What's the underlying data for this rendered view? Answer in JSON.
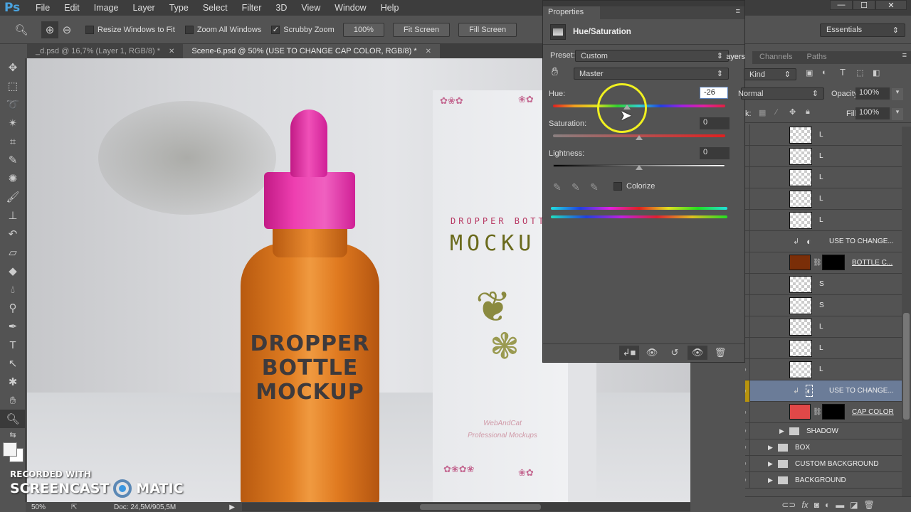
{
  "app": {
    "logo": "Ps"
  },
  "menu": [
    "File",
    "Edit",
    "Image",
    "Layer",
    "Type",
    "Select",
    "Filter",
    "3D",
    "View",
    "Window",
    "Help"
  ],
  "window_controls": {
    "minimize": "—",
    "maximize": "☐",
    "close": "✕"
  },
  "options_bar": {
    "resize_windows": {
      "label": "Resize Windows to Fit",
      "checked": false
    },
    "zoom_all": {
      "label": "Zoom All Windows",
      "checked": false
    },
    "scrubby_zoom": {
      "label": "Scrubby Zoom",
      "checked": true
    },
    "zoom_100": "100%",
    "fit_screen": "Fit Screen",
    "fill_screen": "Fill Screen",
    "workspace": "Essentials"
  },
  "doc_tabs": [
    {
      "label": "_d.psd @ 16,7% (Layer 1, RGB/8) *",
      "active": false
    },
    {
      "label": "Scene-6.psd @ 50% (USE TO CHANGE CAP COLOR, RGB/8) *",
      "active": true
    }
  ],
  "canvas": {
    "bottle_label": [
      "DROPPER",
      "BOTTLE",
      "MOCKUP"
    ],
    "box_subtitle": "DROPPER BOTT",
    "box_title": "MOCKU",
    "box_brand": "WebAndCat",
    "box_tagline": "Professional Mockups",
    "colors": {
      "cap": "#e83eaa",
      "bottle": "#e07a20"
    }
  },
  "properties": {
    "tab": "Properties",
    "adjustment": "Hue/Saturation",
    "preset_label": "Preset:",
    "preset_value": "Custom",
    "channel": "Master",
    "hue": {
      "label": "Hue:",
      "value": "-26",
      "min": -180,
      "max": 180
    },
    "saturation": {
      "label": "Saturation:",
      "value": "0",
      "min": -100,
      "max": 100
    },
    "lightness": {
      "label": "Lightness:",
      "value": "0",
      "min": -100,
      "max": 100
    },
    "colorize": {
      "label": "Colorize",
      "checked": false
    }
  },
  "layers_panel": {
    "tabs": [
      "Layers",
      "Channels",
      "Paths"
    ],
    "filter": "Kind",
    "blend_mode": "Normal",
    "opacity_label": "Opacity:",
    "opacity": "100%",
    "lock_label": "Lock:",
    "fill_label": "Fill:",
    "fill": "100%",
    "rows": [
      {
        "name": "L",
        "type": "pixel",
        "eye": false
      },
      {
        "name": "L",
        "type": "pixel",
        "eye": false
      },
      {
        "name": "L",
        "type": "pixel",
        "eye": false
      },
      {
        "name": "L",
        "type": "pixel",
        "eye": false
      },
      {
        "name": "L",
        "type": "pixel",
        "eye": false
      },
      {
        "name": "USE TO CHANGE...",
        "type": "adjustment",
        "eye": false
      },
      {
        "name": "BOTTLE C...",
        "type": "fill",
        "color": "#7a2e08",
        "eye": false
      },
      {
        "name": "S",
        "type": "pixel",
        "eye": false
      },
      {
        "name": "S",
        "type": "pixel",
        "eye": false
      },
      {
        "name": "L",
        "type": "pixel",
        "eye": false
      },
      {
        "name": "L",
        "type": "pixel",
        "eye": false
      },
      {
        "name": "L",
        "type": "pixel",
        "eye": true
      },
      {
        "name": "USE TO CHANGE...",
        "type": "adjustment",
        "eye": true,
        "selected": true
      },
      {
        "name": "CAP COLOR",
        "type": "fill",
        "color": "#e04848",
        "eye": true
      },
      {
        "name": "SHADOW",
        "type": "group",
        "eye": true
      },
      {
        "name": "BOX",
        "type": "group",
        "eye": true
      },
      {
        "name": "CUSTOM BACKGROUND",
        "type": "group",
        "eye": true
      },
      {
        "name": "BACKGROUND",
        "type": "group",
        "eye": true
      }
    ]
  },
  "status": {
    "zoom": "50%",
    "doc": "Doc: 24,5M/905,5M"
  },
  "watermark": {
    "line1": "RECORDED WITH",
    "line2": "SCREENCAST",
    "line3": "MATIC"
  }
}
